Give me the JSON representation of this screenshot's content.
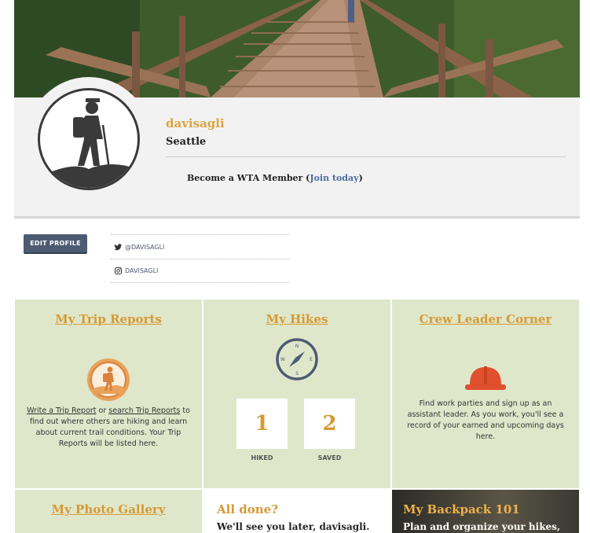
{
  "profile": {
    "username": "davisagli",
    "city": "Seattle",
    "member_prefix": "Become a WTA Member (",
    "member_link": "Join today",
    "member_suffix": ")"
  },
  "actions": {
    "edit_profile": "EDIT PROFILE"
  },
  "social": [
    {
      "icon": "twitter-icon",
      "handle": "@DAVISAGLI"
    },
    {
      "icon": "instagram-icon",
      "handle": "DAVISAGLI"
    }
  ],
  "tiles": {
    "trip_reports": {
      "title": "My Trip Reports",
      "link_write": "Write a Trip Report",
      "or": " or ",
      "link_search": "search Trip Reports",
      "body": "to find out where others are hiking and learn about current trail conditions. Your Trip Reports will be listed here."
    },
    "hikes": {
      "title": "My Hikes",
      "hiked_count": "1",
      "hiked_label": "HIKED",
      "saved_count": "2",
      "saved_label": "SAVED"
    },
    "crew_leader": {
      "title": "Crew Leader Corner",
      "body": "Find work parties and sign up as an assistant leader. As you work, you'll see a record of your earned and upcoming days here."
    },
    "photo_gallery": {
      "title": "My Photo Gallery"
    },
    "all_done": {
      "title": "All done?",
      "subtitle": "We'll see you later, davisagli."
    },
    "backpack": {
      "title": "My Backpack 101",
      "subtitle": "Plan and organize your hikes,"
    }
  },
  "colors": {
    "accent": "#d69a35",
    "tile_bg": "#dfe7cb",
    "button": "#4d5a72"
  }
}
